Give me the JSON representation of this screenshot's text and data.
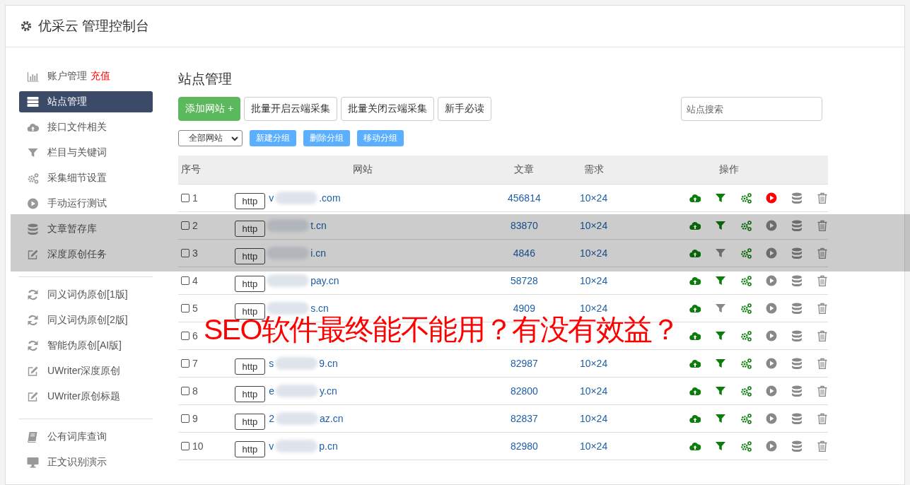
{
  "header": {
    "title": "优采云 管理控制台"
  },
  "sidebar": {
    "groups": [
      [
        {
          "kind": "bar-chart",
          "label": "账户管理",
          "badge": "充值",
          "selected": false
        },
        {
          "kind": "server",
          "label": "站点管理",
          "selected": true
        },
        {
          "kind": "cloud",
          "label": "接口文件相关",
          "selected": false
        },
        {
          "kind": "filter",
          "label": "栏目与关键词",
          "selected": false
        },
        {
          "kind": "gears",
          "label": "采集细节设置",
          "selected": false
        },
        {
          "kind": "play",
          "label": "手动运行测试",
          "selected": false
        },
        {
          "kind": "database",
          "label": "文章暂存库",
          "selected": false
        },
        {
          "kind": "edit",
          "label": "深度原创任务",
          "selected": false
        }
      ],
      [
        {
          "kind": "refresh",
          "label": "同义词伪原创[1版]",
          "selected": false
        },
        {
          "kind": "refresh",
          "label": "同义词伪原创[2版]",
          "selected": false
        },
        {
          "kind": "refresh",
          "label": "智能伪原创[AI版]",
          "selected": false
        },
        {
          "kind": "edit",
          "label": "UWriter深度原创",
          "selected": false
        },
        {
          "kind": "edit",
          "label": "UWriter原创标题",
          "selected": false
        }
      ],
      [
        {
          "kind": "book",
          "label": "公有词库查询",
          "selected": false
        },
        {
          "kind": "monitor",
          "label": "正文识别演示",
          "selected": false
        }
      ]
    ]
  },
  "main": {
    "title": "站点管理",
    "buttons": [
      {
        "label": "添加网站 +",
        "kind": "primary"
      },
      {
        "label": "批量开启云端采集",
        "kind": "default"
      },
      {
        "label": "批量关闭云端采集",
        "kind": "default"
      },
      {
        "label": "新手必读",
        "kind": "default"
      }
    ],
    "search": {
      "placeholder": "站点搜索"
    },
    "group_select": {
      "value": "全部网站"
    },
    "group_buttons": [
      "新建分组",
      "删除分组",
      "移动分组"
    ],
    "table": {
      "columns": [
        "序号",
        "网站",
        "文章",
        "需求",
        "操作"
      ],
      "rows": [
        {
          "no": "1",
          "checked": false,
          "protocol": "http",
          "site_start": "v",
          "site_end": ".com",
          "articles": "456814",
          "demand": "10×24",
          "filter_on": true,
          "running": true
        },
        {
          "no": "2",
          "checked": false,
          "protocol": "http",
          "site_start": "",
          "site_end": "t.cn",
          "articles": "83870",
          "demand": "10×24",
          "filter_on": true,
          "running": false
        },
        {
          "no": "3",
          "checked": false,
          "protocol": "http",
          "site_start": "",
          "site_end": "i.cn",
          "articles": "4846",
          "demand": "10×24",
          "filter_on": false,
          "running": false
        },
        {
          "no": "4",
          "checked": false,
          "protocol": "http",
          "site_start": "",
          "site_end": "pay.cn",
          "articles": "58728",
          "demand": "10×24",
          "filter_on": true,
          "running": false
        },
        {
          "no": "5",
          "checked": false,
          "protocol": "http",
          "site_start": "",
          "site_end": "s.cn",
          "articles": "4909",
          "demand": "10×24",
          "filter_on": false,
          "running": false
        },
        {
          "no": "6",
          "checked": false,
          "filter_on": true,
          "running": false
        },
        {
          "no": "7",
          "checked": false,
          "protocol": "http",
          "site_start": "s",
          "site_end": "9.cn",
          "articles": "82987",
          "demand": "10×24",
          "filter_on": true,
          "running": false
        },
        {
          "no": "8",
          "checked": false,
          "protocol": "http",
          "site_start": "e",
          "site_end": "y.cn",
          "articles": "82800",
          "demand": "10×24",
          "filter_on": true,
          "running": false
        },
        {
          "no": "9",
          "checked": false,
          "protocol": "http",
          "site_start": "2",
          "site_end": "az.cn",
          "articles": "82837",
          "demand": "10×24",
          "filter_on": true,
          "running": false
        },
        {
          "no": "10",
          "checked": false,
          "protocol": "http",
          "site_start": "v",
          "site_end": "p.cn",
          "articles": "82980",
          "demand": "10×24",
          "filter_on": true,
          "running": false
        }
      ]
    }
  },
  "overlay_caption": "SEO软件最终能不能用？有没有效益？"
}
